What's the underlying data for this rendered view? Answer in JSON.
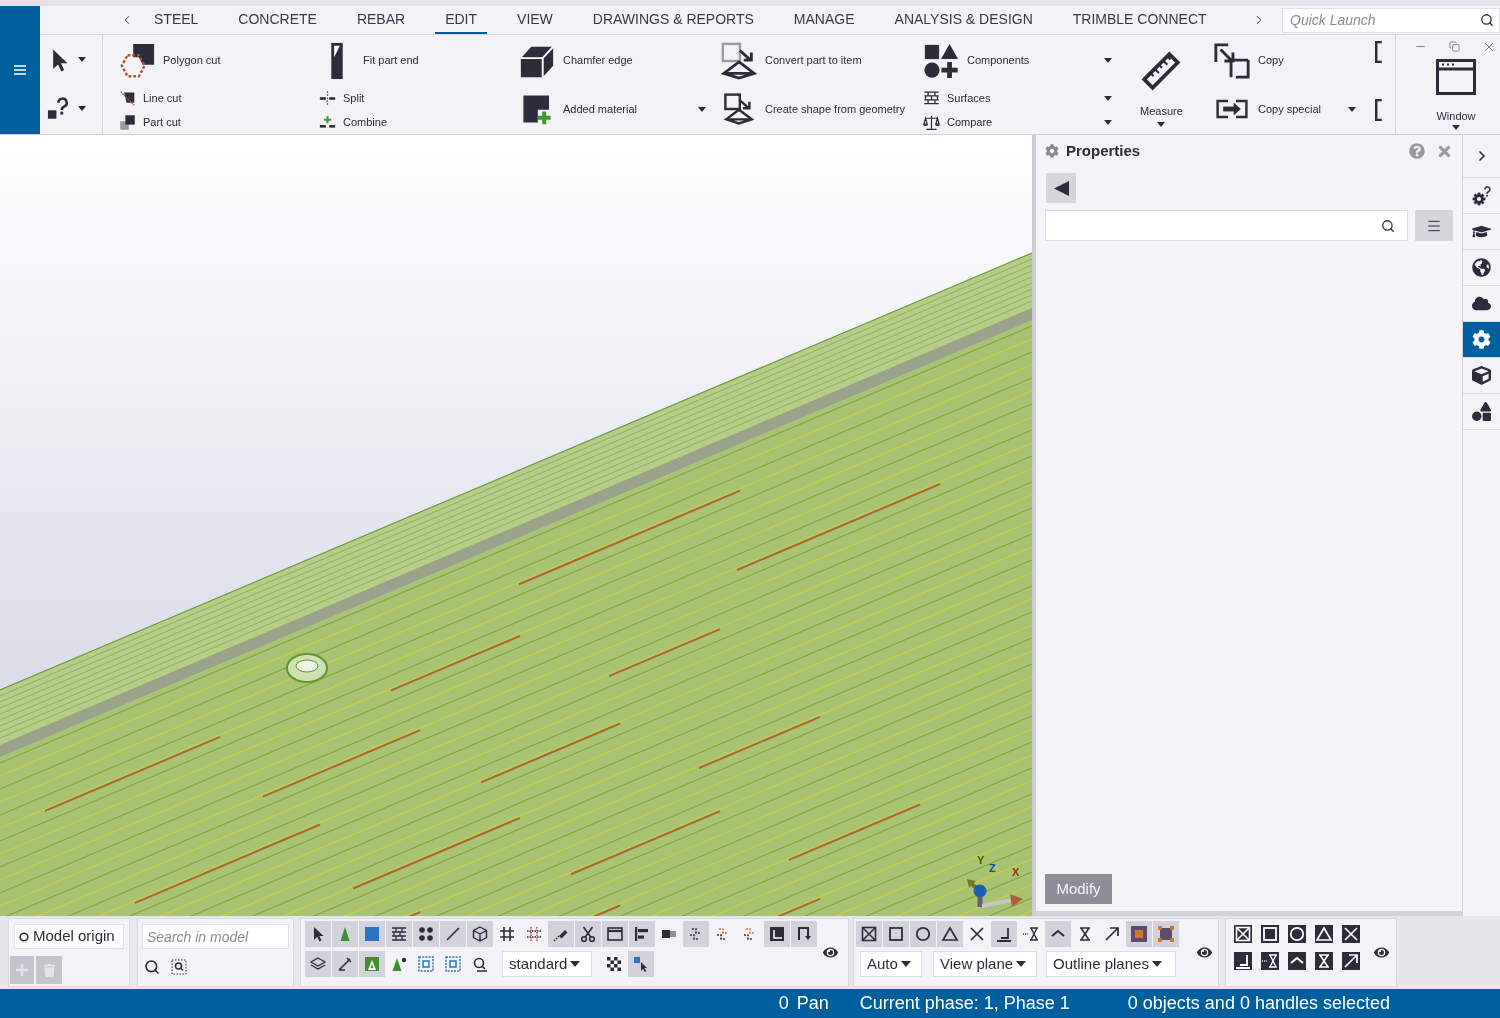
{
  "tab_bar": {
    "tabs": [
      {
        "label": "STEEL",
        "selected": false
      },
      {
        "label": "CONCRETE",
        "selected": false
      },
      {
        "label": "REBAR",
        "selected": false
      },
      {
        "label": "EDIT",
        "selected": true
      },
      {
        "label": "VIEW",
        "selected": false
      },
      {
        "label": "DRAWINGS & REPORTS",
        "selected": false
      },
      {
        "label": "MANAGE",
        "selected": false
      },
      {
        "label": "ANALYSIS & DESIGN",
        "selected": false
      },
      {
        "label": "TRIMBLE CONNECT",
        "selected": false
      }
    ],
    "quick_launch": {
      "placeholder": "Quick Launch"
    }
  },
  "ribbon": {
    "tools": [
      {
        "kind": "select",
        "dropdown": true
      },
      {
        "kind": "inquire",
        "dropdown": true
      }
    ],
    "groups": [
      {
        "kind": "stack",
        "items": [
          {
            "kind": "polygon-cut",
            "label": "Polygon cut"
          },
          {
            "kind": "line-cut",
            "label": "Line cut"
          },
          {
            "kind": "part-cut",
            "label": "Part cut"
          }
        ]
      },
      {
        "kind": "stack",
        "items": [
          {
            "kind": "fit-part-end",
            "label": "Fit part end"
          },
          {
            "kind": "split",
            "label": "Split"
          },
          {
            "kind": "combine",
            "label": "Combine"
          }
        ]
      },
      {
        "kind": "stack",
        "items": [
          {
            "kind": "chamfer-edge",
            "label": "Chamfer edge"
          },
          {
            "kind": "added-material",
            "label": "Added material",
            "dropdown": true
          }
        ]
      },
      {
        "kind": "stack",
        "items": [
          {
            "kind": "convert-part",
            "label": "Convert part to item"
          },
          {
            "kind": "create-shape",
            "label": "Create shape from geometry"
          }
        ]
      },
      {
        "kind": "stack",
        "items": [
          {
            "kind": "components",
            "label": "Components",
            "dropdown": true
          },
          {
            "kind": "surfaces",
            "label": "Surfaces",
            "dropdown": true
          },
          {
            "kind": "compare",
            "label": "Compare",
            "dropdown": true
          }
        ]
      },
      {
        "kind": "vertical",
        "items": [
          {
            "kind": "measure",
            "label": "Measure",
            "dropdown": true
          }
        ]
      },
      {
        "kind": "stack",
        "items": [
          {
            "kind": "copy",
            "label": "Copy"
          },
          {
            "kind": "copy-special",
            "label": "Copy special",
            "dropdown": true
          }
        ]
      },
      {
        "kind": "overflow",
        "items": [
          {
            "kind": "bracket"
          },
          {
            "kind": "bracket"
          }
        ]
      }
    ],
    "window": {
      "label": "Window",
      "dropdown": true
    }
  },
  "model_view": {
    "axis_labels": [
      {
        "kind": "y",
        "label": "Y"
      },
      {
        "kind": "z",
        "label": "Z"
      },
      {
        "kind": "x",
        "label": "X"
      }
    ]
  },
  "properties_panel": {
    "title": "Properties",
    "modify_button": {
      "label": "Modify",
      "disabled": true
    }
  },
  "side_bar": {
    "items": [
      {
        "kind": "gear-help",
        "selected": false
      },
      {
        "kind": "cap",
        "selected": false
      },
      {
        "kind": "globe",
        "selected": false
      },
      {
        "kind": "cloud",
        "selected": false
      },
      {
        "kind": "gear",
        "selected": true
      },
      {
        "kind": "cube",
        "selected": false
      },
      {
        "kind": "shapes",
        "selected": false
      }
    ]
  },
  "bottom_toolbar": {
    "work_plane": {
      "value": "Model origin",
      "buttons": [
        {
          "kind": "add",
          "disabled": true
        },
        {
          "kind": "delete",
          "disabled": true
        }
      ]
    },
    "model_search": {
      "placeholder": "Search in model"
    },
    "selection_switches": {
      "row_1": [
        {
          "kind": "arrow",
          "selected": true
        },
        {
          "kind": "cone",
          "selected": true
        },
        {
          "kind": "blue-square",
          "selected": true
        },
        {
          "kind": "brick",
          "selected": true
        },
        {
          "kind": "dots",
          "selected": true
        },
        {
          "kind": "line",
          "selected": true
        },
        {
          "kind": "cube",
          "selected": true
        },
        {
          "kind": "grid",
          "selected": false
        },
        {
          "kind": "grid-dotted",
          "selected": false
        },
        {
          "kind": "pencil",
          "selected": true
        },
        {
          "kind": "scissors",
          "selected": true
        },
        {
          "kind": "window",
          "selected": true
        },
        {
          "kind": "align",
          "selected": true
        },
        {
          "kind": "tee",
          "selected": false
        },
        {
          "kind": "dashed",
          "selected": true
        },
        {
          "kind": "dashed-orange",
          "selected": false
        },
        {
          "kind": "dashed-orange",
          "selected": false
        },
        {
          "kind": "frame",
          "selected": true
        },
        {
          "kind": "bracket-down",
          "selected": true
        }
      ],
      "row_2": [
        {
          "kind": "layers",
          "selected": true
        },
        {
          "kind": "angle",
          "selected": true
        },
        {
          "kind": "green-box",
          "selected": true
        },
        {
          "kind": "cone-dot",
          "selected": false
        },
        {
          "kind": "dotted-square",
          "selected": false
        },
        {
          "kind": "dotted-square",
          "selected": false
        },
        {
          "kind": "zoom-part",
          "selected": false
        },
        {
          "kind": "dropdown",
          "value": "standard"
        },
        {
          "kind": "checker",
          "selected": false
        },
        {
          "kind": "cursor-box",
          "selected": true
        }
      ]
    },
    "snap_switches": {
      "row_1": [
        {
          "kind": "box-x",
          "selected": true
        },
        {
          "kind": "square-outline",
          "selected": true
        },
        {
          "kind": "circle",
          "selected": true
        },
        {
          "kind": "triangle",
          "selected": true
        },
        {
          "kind": "cross",
          "selected": false
        },
        {
          "kind": "corner",
          "selected": true
        },
        {
          "kind": "hourglass-dotted",
          "selected": false
        },
        {
          "kind": "chevron",
          "selected": true
        },
        {
          "kind": "hourglass",
          "selected": false
        },
        {
          "kind": "arrow-diag",
          "selected": false
        },
        {
          "kind": "orange-square",
          "selected": true
        },
        {
          "kind": "corner-square",
          "selected": true
        }
      ],
      "row_2": [
        {
          "kind": "dropdown",
          "value": "Auto"
        },
        {
          "kind": "dropdown",
          "value": "View plane"
        },
        {
          "kind": "dropdown",
          "value": "Outline planes"
        }
      ]
    },
    "snap_overrides": {
      "row_1": [
        {
          "kind": "box-x"
        },
        {
          "kind": "square-outline"
        },
        {
          "kind": "circle"
        },
        {
          "kind": "triangle"
        },
        {
          "kind": "cross"
        }
      ],
      "row_2": [
        {
          "kind": "corner"
        },
        {
          "kind": "hourglass-dotted"
        },
        {
          "kind": "chevron"
        },
        {
          "kind": "hourglass"
        },
        {
          "kind": "arrow-diag"
        }
      ]
    }
  },
  "status_bar": {
    "count": "0",
    "mode": "Pan",
    "phase": "Current phase: 1, Phase 1",
    "selection": "0 objects and 0 handles selected"
  }
}
